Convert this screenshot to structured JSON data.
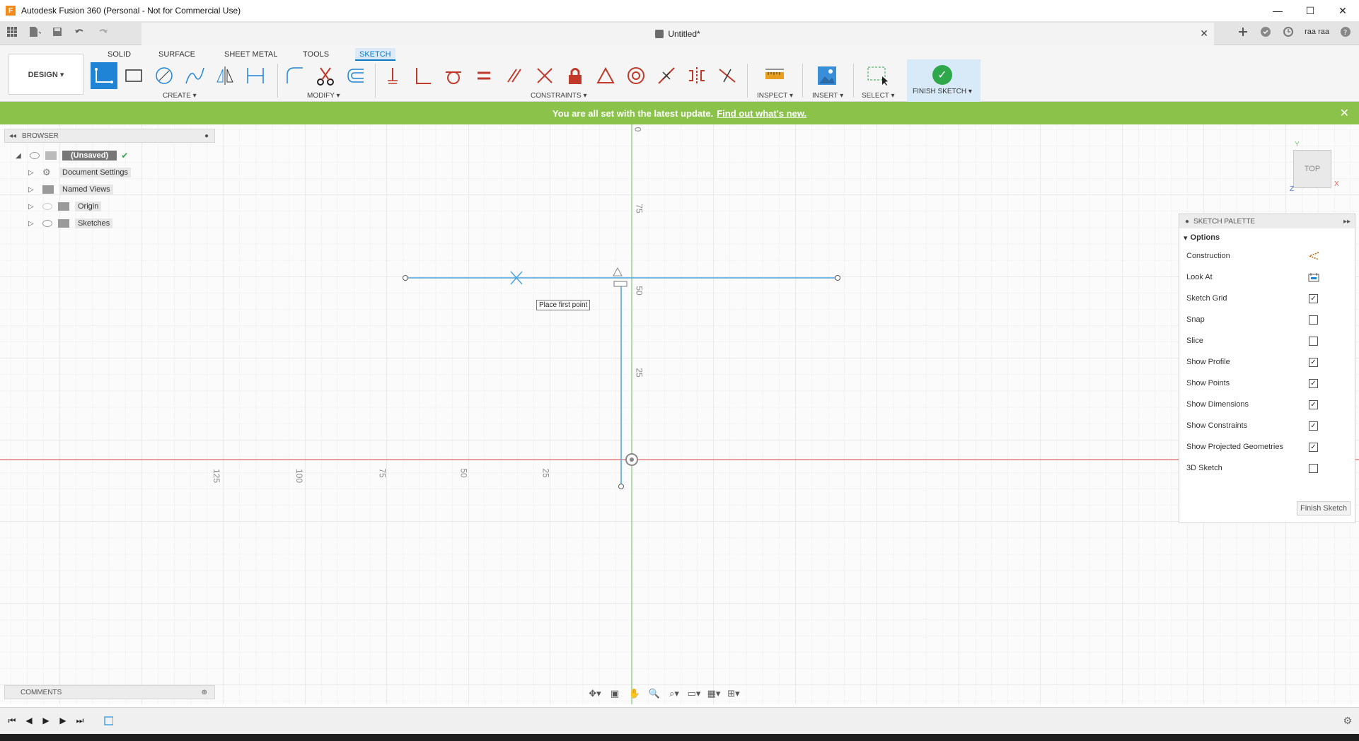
{
  "window": {
    "title": "Autodesk Fusion 360 (Personal - Not for Commercial Use)",
    "logo_letter": "F",
    "minimize": "—",
    "maximize": "☐",
    "close": "✕"
  },
  "document_tab": {
    "title": "Untitled*",
    "close": "✕"
  },
  "user": {
    "name": "raa raa"
  },
  "workspace": {
    "label": "DESIGN ▾"
  },
  "tabs": [
    {
      "label": "SOLID"
    },
    {
      "label": "SURFACE"
    },
    {
      "label": "SHEET METAL"
    },
    {
      "label": "TOOLS"
    },
    {
      "label": "SKETCH"
    }
  ],
  "groups": {
    "create": "CREATE ▾",
    "modify": "MODIFY ▾",
    "constraints": "CONSTRAINTS ▾",
    "inspect": "INSPECT ▾",
    "insert": "INSERT ▾",
    "select": "SELECT ▾",
    "finish": "FINISH SKETCH ▾"
  },
  "banner": {
    "message": "You are all set with the latest update.",
    "link": "Find out what's new.",
    "close": "✕"
  },
  "browser": {
    "title": "BROWSER",
    "items": [
      {
        "label": "(Unsaved)"
      },
      {
        "label": "Document Settings"
      },
      {
        "label": "Named Views"
      },
      {
        "label": "Origin"
      },
      {
        "label": "Sketches"
      }
    ]
  },
  "canvas": {
    "tooltip": "Place first point",
    "vertical_ticks": [
      "0",
      "75",
      "50",
      "25"
    ],
    "horizontal_ticks": [
      "125",
      "100",
      "75",
      "50",
      "25"
    ]
  },
  "viewcube": {
    "face": "TOP",
    "x": "X",
    "y": "Y",
    "z": "Z"
  },
  "palette": {
    "title": "SKETCH PALETTE",
    "section": "Options",
    "rows": [
      {
        "label": "Construction",
        "kind": "icon",
        "icon": "construction-icon"
      },
      {
        "label": "Look At",
        "kind": "icon",
        "icon": "look-at-icon"
      },
      {
        "label": "Sketch Grid",
        "checked": true
      },
      {
        "label": "Snap",
        "checked": false
      },
      {
        "label": "Slice",
        "checked": false
      },
      {
        "label": "Show Profile",
        "checked": true
      },
      {
        "label": "Show Points",
        "checked": true
      },
      {
        "label": "Show Dimensions",
        "checked": true
      },
      {
        "label": "Show Constraints",
        "checked": true
      },
      {
        "label": "Show Projected Geometries",
        "checked": true
      },
      {
        "label": "3D Sketch",
        "checked": false
      }
    ],
    "finish_button": "Finish Sketch"
  },
  "comments": {
    "title": "COMMENTS"
  },
  "colors": {
    "accent": "#1f84d6",
    "banner": "#8bc34a",
    "sketch_line": "#4aa3df",
    "x_axis": "#e06666",
    "y_axis": "#7bc96f"
  }
}
